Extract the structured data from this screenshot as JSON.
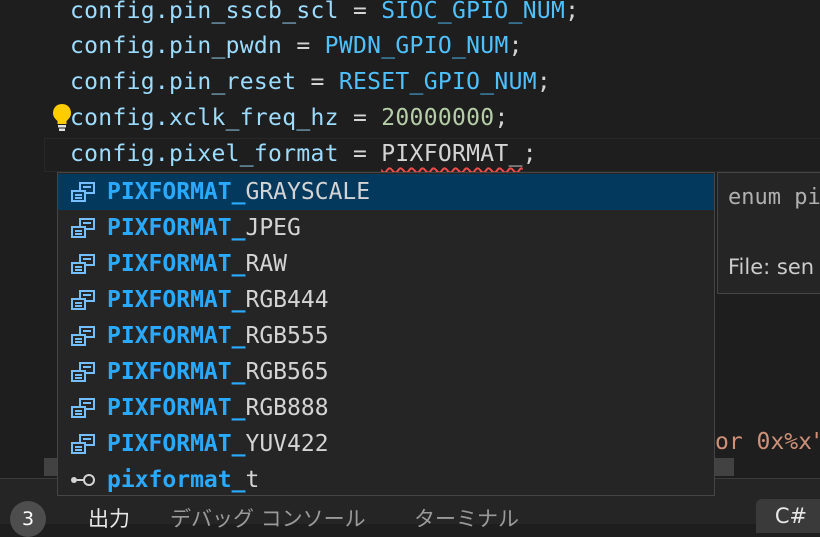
{
  "editor": {
    "lines": [
      {
        "var": "config.pin_sscb_scl",
        "op": " = ",
        "value": "SIOC_GPIO_NUM",
        "end": ";"
      },
      {
        "var": "config.pin_pwdn",
        "op": " = ",
        "value": "PWDN_GPIO_NUM",
        "end": ";"
      },
      {
        "var": "config.pin_reset",
        "op": " = ",
        "value": "RESET_GPIO_NUM",
        "end": ";"
      },
      {
        "var": "config.xclk_freq_hz",
        "op": " = ",
        "value": "20000000",
        "end": ";"
      },
      {
        "var": "config.pixel_format",
        "op": " = ",
        "value": "PIXFORMAT_",
        "end": ";"
      }
    ],
    "partial_hidden_text": "or 0x%x\""
  },
  "suggest": {
    "items": [
      {
        "match": "PIXFORMAT_",
        "rest": "GRAYSCALE",
        "icon": "enum-member-icon",
        "selected": true
      },
      {
        "match": "PIXFORMAT_",
        "rest": "JPEG",
        "icon": "enum-member-icon"
      },
      {
        "match": "PIXFORMAT_",
        "rest": "RAW",
        "icon": "enum-member-icon"
      },
      {
        "match": "PIXFORMAT_",
        "rest": "RGB444",
        "icon": "enum-member-icon"
      },
      {
        "match": "PIXFORMAT_",
        "rest": "RGB555",
        "icon": "enum-member-icon"
      },
      {
        "match": "PIXFORMAT_",
        "rest": "RGB565",
        "icon": "enum-member-icon"
      },
      {
        "match": "PIXFORMAT_",
        "rest": "RGB888",
        "icon": "enum-member-icon"
      },
      {
        "match": "PIXFORMAT_",
        "rest": "YUV422",
        "icon": "enum-member-icon"
      },
      {
        "match": "pixformat_",
        "rest": "t",
        "icon": "type-parameter-icon"
      }
    ],
    "details": {
      "signature": "enum pi",
      "file": "File: sen"
    }
  },
  "panel": {
    "badge": "3",
    "tabs": [
      "出力",
      "デバッグ コンソール",
      "ターミナル"
    ],
    "language": "C#"
  },
  "colors": {
    "background": "#1e1e1e",
    "variable": "#9cdcfe",
    "enum_constant": "#4fc1ff",
    "number": "#b5cea8",
    "match_highlight": "#2aaaff",
    "selected_row": "#04395e",
    "error_squiggle": "#f14c4c",
    "lightbulb": "#ffcc00"
  }
}
